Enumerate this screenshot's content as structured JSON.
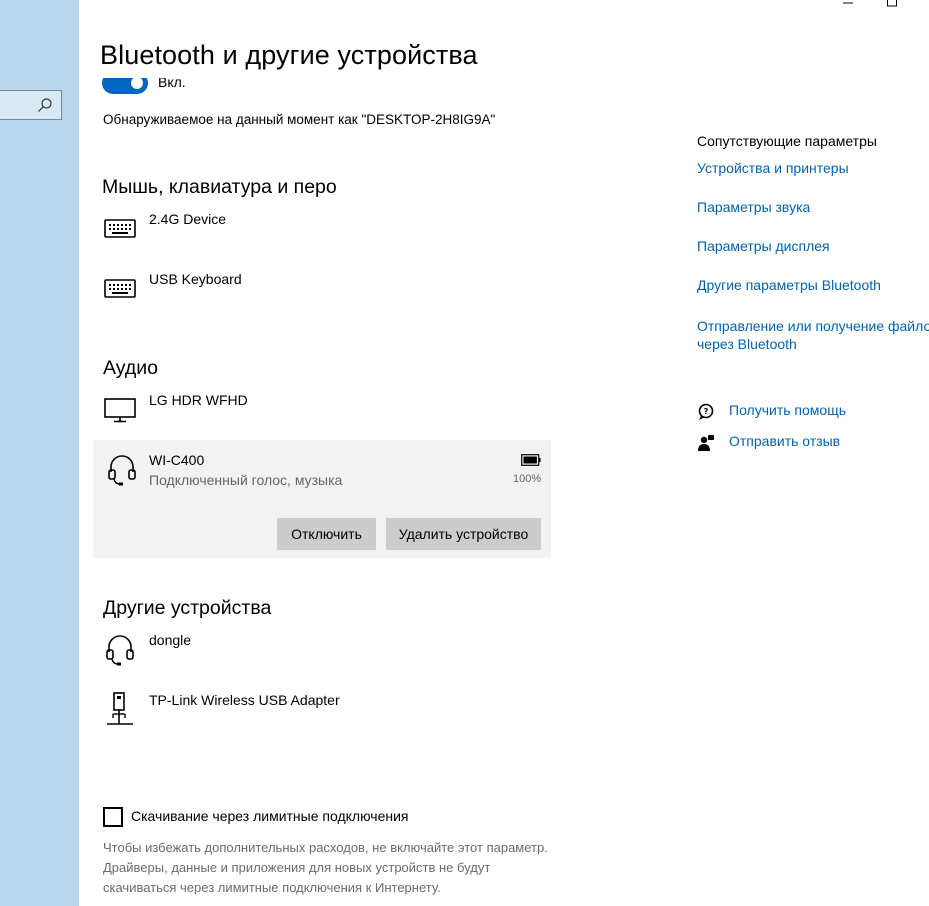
{
  "window": {
    "minimize_glyph": "—",
    "maximize_glyph": "☐"
  },
  "page": {
    "title": "Bluetooth и другие устройства"
  },
  "bluetooth": {
    "toggle_label": "Вкл.",
    "toggle_on": true,
    "discoverable_text": "Обнаруживаемое на данный момент как \"DESKTOP-2H8IG9A\""
  },
  "sections": {
    "input": {
      "title": "Мышь, клавиатура и перо",
      "devices": [
        {
          "name": "2.4G Device",
          "icon": "keyboard-icon"
        },
        {
          "name": "USB Keyboard",
          "icon": "keyboard-icon"
        }
      ]
    },
    "audio": {
      "title": "Аудио",
      "devices": [
        {
          "name": "LG HDR WFHD",
          "icon": "monitor-icon"
        },
        {
          "name": "WI-C400",
          "status": "Подключенный голос, музыка",
          "battery": "100%",
          "icon": "headset-icon",
          "selected": true
        }
      ],
      "actions": {
        "disconnect": "Отключить",
        "remove": "Удалить устройство"
      }
    },
    "other": {
      "title": "Другие устройства",
      "devices": [
        {
          "name": "dongle",
          "icon": "headset-icon"
        },
        {
          "name": "TP-Link Wireless USB Adapter",
          "icon": "usb-adapter-icon"
        }
      ]
    }
  },
  "metered": {
    "checkbox_label": "Скачивание через лимитные подключения",
    "checked": false,
    "note": "Чтобы избежать дополнительных расходов, не включайте этот параметр. Драйверы, данные и приложения для новых устройств не будут скачиваться через лимитные подключения к Интернету."
  },
  "related": {
    "title": "Сопутствующие параметры",
    "links": [
      "Устройства и принтеры",
      "Параметры звука",
      "Параметры дисплея",
      "Другие параметры Bluetooth"
    ],
    "send_files_line1": "Отправление или получение файлов",
    "send_files_line2": "через Bluetooth"
  },
  "help": {
    "get_help": "Получить помощь",
    "feedback": "Отправить отзыв"
  },
  "colors": {
    "accent": "#0067c0",
    "link": "#0063b1",
    "nav_background": "#b9d6ef",
    "selected_card": "#f2f2f2",
    "button": "#cccccc"
  }
}
